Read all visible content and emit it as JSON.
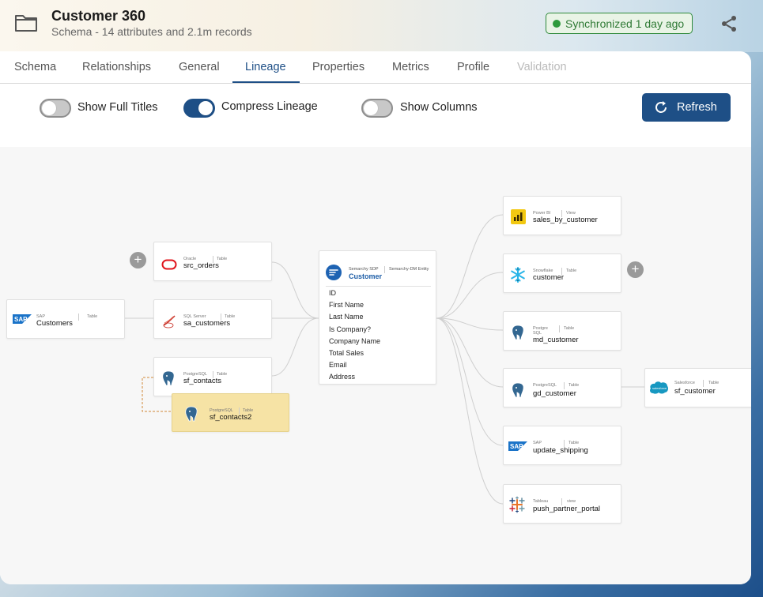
{
  "header": {
    "title": "Customer 360",
    "subtitle": "Schema - 14 attributes and 2.1m records",
    "sync_status": "Synchronized 1 day ago",
    "folder_icon": "folder-icon",
    "share_icon": "share-icon"
  },
  "tabs": [
    {
      "label": "Schema"
    },
    {
      "label": "Relationships"
    },
    {
      "label": "General"
    },
    {
      "label": "Lineage",
      "active": true
    },
    {
      "label": "Properties"
    },
    {
      "label": "Metrics"
    },
    {
      "label": "Profile"
    },
    {
      "label": "Validation",
      "disabled": true
    }
  ],
  "controls": {
    "show_full_titles": {
      "label": "Show Full Titles",
      "on": false
    },
    "compress_lineage": {
      "label": "Compress Lineage",
      "on": true
    },
    "show_columns": {
      "label": "Show Columns",
      "on": false
    },
    "refresh_label": "Refresh"
  },
  "lineage": {
    "center": {
      "system": "Semarchy SDP",
      "kind": "Semarchy-DM Entity",
      "name": "Customer",
      "attributes": [
        "ID",
        "First Name",
        "Last Name",
        "Is Company?",
        "Company Name",
        "Total Sales",
        "Email",
        "Address"
      ]
    },
    "upstream": [
      {
        "system": "Oracle",
        "kind": "Table",
        "name": "src_orders",
        "icon": "oracle-icon"
      },
      {
        "system": "SQL Server",
        "kind": "Table",
        "name": "sa_customers",
        "icon": "sql-server-icon"
      },
      {
        "system": "PostgreSQL",
        "kind": "Table",
        "name": "sf_contacts",
        "icon": "postgresql-icon"
      },
      {
        "system": "PostgreSQL",
        "kind": "Table",
        "name": "sf_contacts2",
        "icon": "postgresql-icon"
      },
      {
        "system": "SAP",
        "kind": "Table",
        "name": "Customers",
        "icon": "sap-icon"
      }
    ],
    "downstream": [
      {
        "system": "Power BI",
        "kind": "View",
        "name": "sales_by_customer",
        "icon": "power-bi-icon"
      },
      {
        "system": "Snowflake",
        "kind": "Table",
        "name": "customer",
        "icon": "snowflake-icon"
      },
      {
        "system": "Postgre SQL",
        "kind": "Table",
        "name": "md_customer",
        "icon": "postgresql-icon"
      },
      {
        "system": "PostgreSQL",
        "kind": "Table",
        "name": "gd_customer",
        "icon": "postgresql-icon"
      },
      {
        "system": "SAP",
        "kind": "Table",
        "name": "update_shipping",
        "icon": "sap-icon"
      },
      {
        "system": "Tableau",
        "kind": "view",
        "name": "push_partner_portal",
        "icon": "tableau-icon"
      },
      {
        "system": "Salesforce",
        "kind": "Table",
        "name": "sf_customer",
        "icon": "salesforce-icon"
      }
    ],
    "expand_label": "+",
    "colors": {
      "highlight": "#f6e3a5",
      "accent": "#1e4f86",
      "sync": "#2e9a3c"
    }
  }
}
